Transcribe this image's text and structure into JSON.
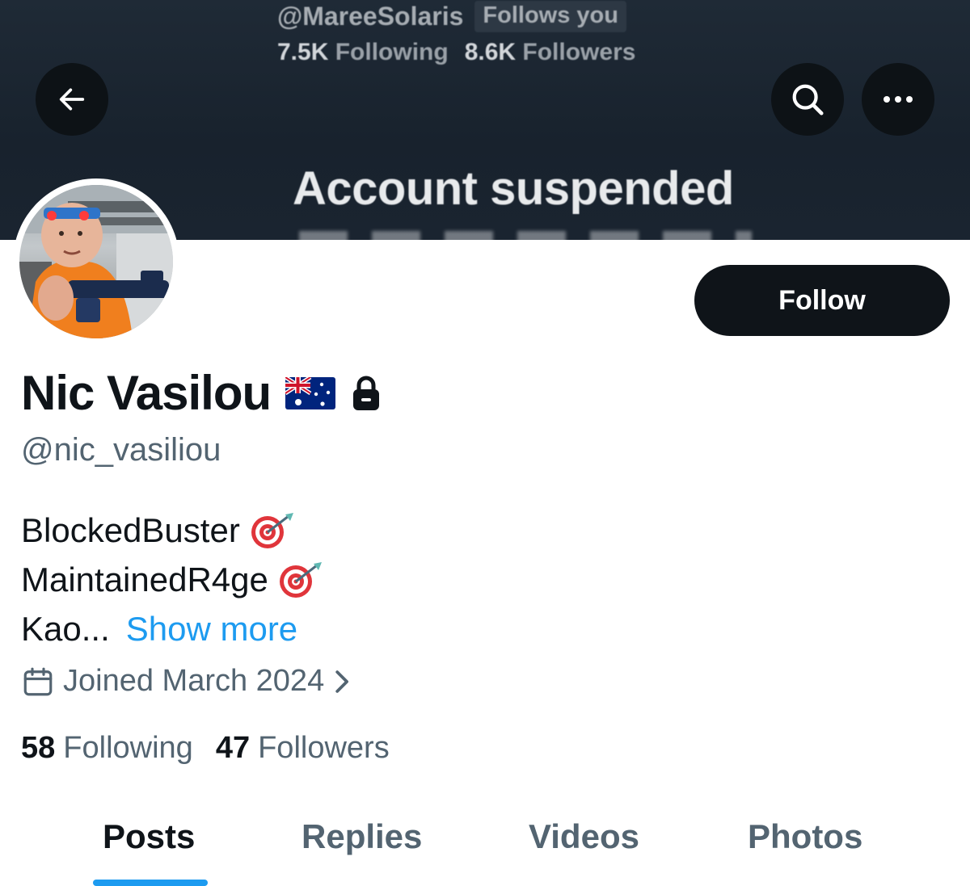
{
  "banner": {
    "handle": "@MareeSolaris",
    "follows_badge": "Follows you",
    "following_count": "7.5K",
    "following_label": "Following",
    "followers_count": "8.6K",
    "followers_label": "Followers",
    "status_title": "Account suspended"
  },
  "nav": {
    "back_icon": "arrow-left-icon",
    "search_icon": "search-icon",
    "more_icon": "more-dots-icon"
  },
  "profile": {
    "display_name": "Nic Vasilou",
    "flag_icon": "australia-flag-icon",
    "lock_icon": "lock-icon",
    "handle": "@nic_vasiliou",
    "follow_label": "Follow",
    "bio": {
      "line1": "BlockedBuster",
      "line2": "MaintainedR4ge",
      "line3": "Kao...",
      "show_more": "Show more"
    },
    "joined": "Joined March 2024",
    "following_count": "58",
    "following_label": "Following",
    "followers_count": "47",
    "followers_label": "Followers"
  },
  "tabs": [
    {
      "label": "Posts",
      "active": true
    },
    {
      "label": "Replies",
      "active": false
    },
    {
      "label": "Videos",
      "active": false
    },
    {
      "label": "Photos",
      "active": false
    }
  ],
  "colors": {
    "accent": "#1d9bf0",
    "text_primary": "#0f1419",
    "text_secondary": "#536471",
    "banner_bg": "#1b2530"
  }
}
